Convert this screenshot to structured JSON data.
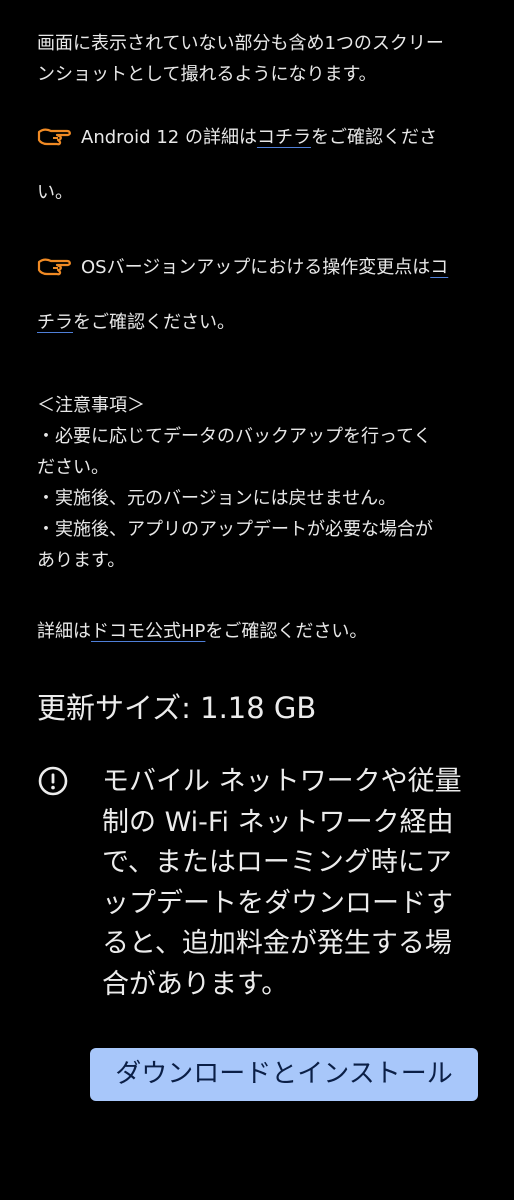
{
  "intro": {
    "line1": "画面に表示されていない部分も含め1つのスクリー",
    "line2": "ンショットとして撮れるようになります。"
  },
  "android12": {
    "icon": "pointing-hand-icon",
    "prefix": "Android 12 の詳細は",
    "link": "コチラ",
    "suffix1": "をご確認くださ",
    "suffix2": "い。"
  },
  "os_changes": {
    "icon": "pointing-hand-icon",
    "prefix": "OSバージョンアップにおける操作変更点は",
    "link_part1": "コ",
    "link_part2": "チラ",
    "suffix": "をご確認ください。"
  },
  "notes": {
    "heading": "＜注意事項＞",
    "items": [
      "・必要に応じてデータのバックアップを行ってく",
      "ださい。",
      "・実施後、元のバージョンには戻せません。",
      "・実施後、アプリのアップデートが必要な場合が",
      "あります。"
    ]
  },
  "details": {
    "prefix": "詳細は",
    "link": "ドコモ公式HP",
    "suffix": "をご確認ください。"
  },
  "update_size": "更新サイズ: 1.18 GB",
  "warning": {
    "icon": "alert-circle-icon",
    "lines": [
      "モバイル ネットワークや従量",
      "制の Wi-Fi ネットワーク経由",
      "で、またはローミング時にア",
      "ップデートをダウンロードす",
      "ると、追加料金が発生する場",
      "合があります。"
    ]
  },
  "download_button": "ダウンロードとインストール",
  "colors": {
    "background": "#000000",
    "accent_button": "#a8c7fa",
    "hand_icon": "#f08a24",
    "link_underline": "#4f7fd8"
  }
}
